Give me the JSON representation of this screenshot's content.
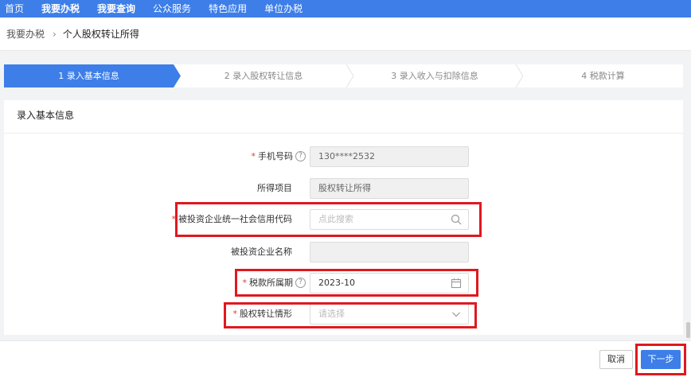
{
  "nav": {
    "items": [
      "首页",
      "我要办税",
      "我要查询",
      "公众服务",
      "特色应用",
      "单位办税"
    ],
    "active_index": 1
  },
  "breadcrumb": {
    "parent": "我要办税",
    "separator": "›",
    "current": "个人股权转让所得"
  },
  "steps": [
    {
      "label": "1  录入基本信息",
      "active": true
    },
    {
      "label": "2  录入股权转让信息",
      "active": false
    },
    {
      "label": "3  录入收入与扣除信息",
      "active": false
    },
    {
      "label": "4  税款计算",
      "active": false
    }
  ],
  "form": {
    "title": "录入基本信息",
    "phone": {
      "label": "手机号码",
      "value": "130****2532",
      "required": true
    },
    "item": {
      "label": "所得项目",
      "value": "股权转让所得"
    },
    "credit_code": {
      "label": "被投资企业统一社会信用代码",
      "placeholder": "点此搜索",
      "required": true
    },
    "company_name": {
      "label": "被投资企业名称",
      "value": ""
    },
    "period": {
      "label": "税款所属期",
      "value": "2023-10",
      "required": true
    },
    "situation": {
      "label": "股权转让情形",
      "placeholder": "请选择",
      "required": true
    }
  },
  "footer": {
    "cancel_label": "取消",
    "next_label": "下一步"
  },
  "colors": {
    "primary": "#3d7ee8",
    "highlight": "#e0181f",
    "required_star": "#e53935"
  }
}
